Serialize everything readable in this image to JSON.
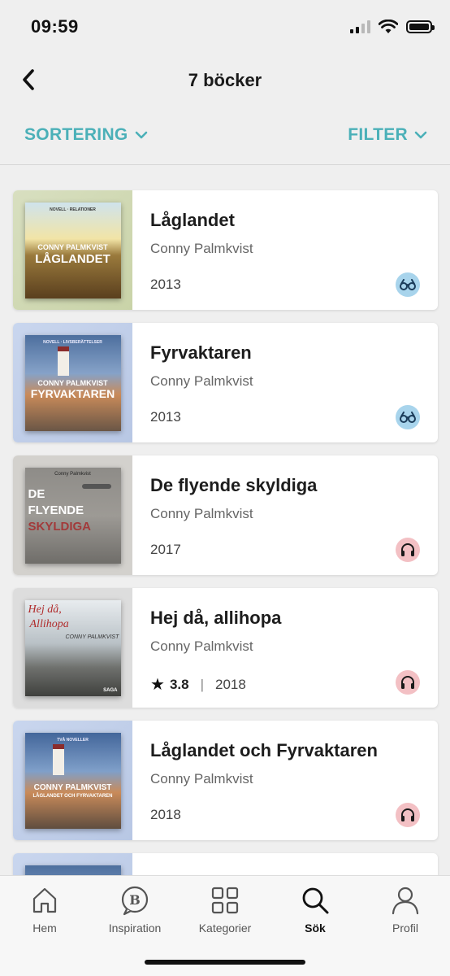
{
  "status_bar": {
    "time": "09:59"
  },
  "header": {
    "title": "7 böcker"
  },
  "toolbar": {
    "sort_label": "SORTERING",
    "filter_label": "FILTER"
  },
  "books": [
    {
      "title": "Låglandet",
      "author": "Conny Palmkvist",
      "year": "2013",
      "format_icon": "ebook-glasses-icon",
      "cover": {
        "top": "NOVELL · RELATIONER",
        "author": "CONNY PALMKVIST",
        "title": "LÅGLANDET"
      }
    },
    {
      "title": "Fyrvaktaren",
      "author": "Conny Palmkvist",
      "year": "2013",
      "format_icon": "ebook-glasses-icon",
      "cover": {
        "top": "NOVELL · LIVSBERÄTTELSER",
        "author": "CONNY PALMKVIST",
        "title": "FYRVAKTAREN"
      }
    },
    {
      "title": "De flyende skyldiga",
      "author": "Conny Palmkvist",
      "year": "2017",
      "format_icon": "headphones-icon",
      "cover": {
        "author": "Conny Palmkvist",
        "line1": "DE",
        "line2": "FLYENDE",
        "line3": "SKYLDIGA"
      }
    },
    {
      "title": "Hej då, allihopa",
      "author": "Conny Palmkvist",
      "year": "2018",
      "rating": "3.8",
      "separator": "|",
      "format_icon": "headphones-icon",
      "cover": {
        "line1": "Hej då,",
        "line2": "Allihopa",
        "author": "CONNY PALMKVIST",
        "publisher": "SAGA"
      }
    },
    {
      "title": "Låglandet och Fyrvaktaren",
      "author": "Conny Palmkvist",
      "year": "2018",
      "format_icon": "headphones-icon",
      "cover": {
        "top": "TVÅ NOVELLER",
        "author": "CONNY PALMKVIST",
        "title": "LÅGLANDET OCH FYRVAKTAREN"
      }
    }
  ],
  "tabs": [
    {
      "label": "Hem",
      "icon": "home-icon"
    },
    {
      "label": "Inspiration",
      "icon": "inspiration-b-icon"
    },
    {
      "label": "Kategorier",
      "icon": "grid-icon"
    },
    {
      "label": "Sök",
      "icon": "search-icon",
      "active": true
    },
    {
      "label": "Profil",
      "icon": "person-icon"
    }
  ]
}
